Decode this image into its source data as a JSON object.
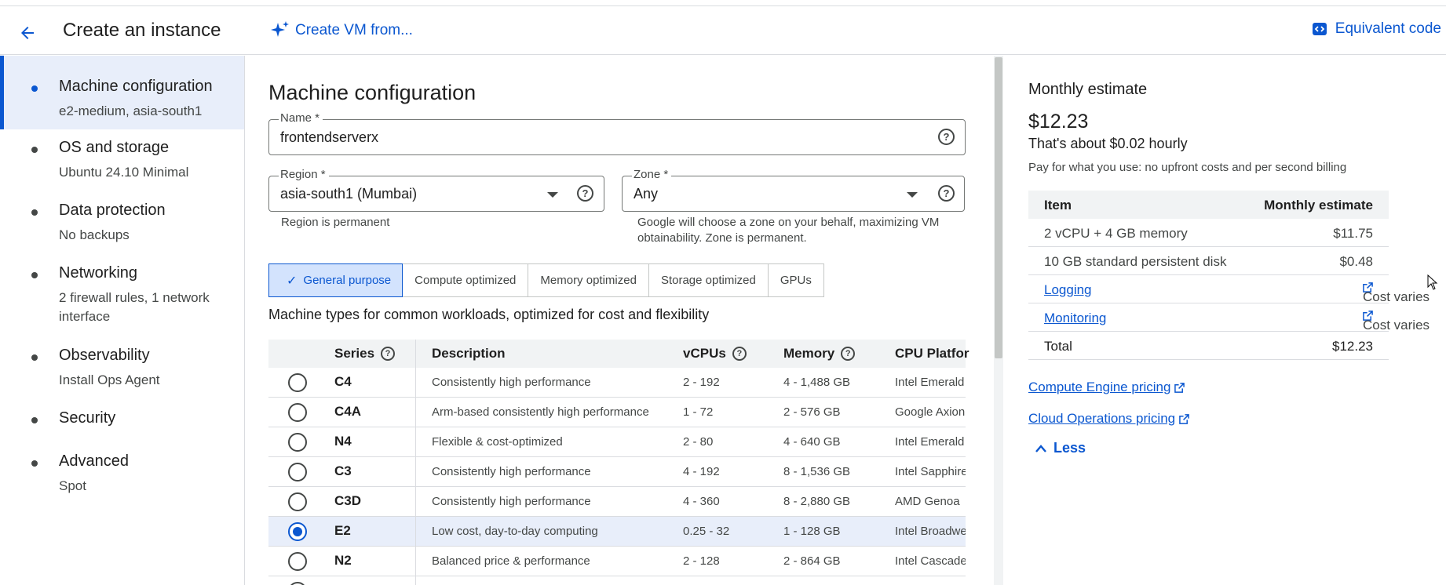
{
  "header": {
    "title": "Create an instance",
    "create_vm_label": "Create VM from...",
    "equivalent_code_label": "Equivalent code"
  },
  "sidebar": {
    "items": [
      {
        "label": "Machine configuration",
        "sub": "e2-medium, asia-south1",
        "active": true
      },
      {
        "label": "OS and storage",
        "sub": "Ubuntu 24.10 Minimal"
      },
      {
        "label": "Data protection",
        "sub": "No backups"
      },
      {
        "label": "Networking",
        "sub": "2 firewall rules, 1 network interface"
      },
      {
        "label": "Observability",
        "sub": "Install Ops Agent"
      },
      {
        "label": "Security",
        "sub": ""
      },
      {
        "label": "Advanced",
        "sub": "Spot"
      }
    ]
  },
  "main": {
    "section_title": "Machine configuration",
    "name_field": {
      "label": "Name *",
      "value": "frontendserverx"
    },
    "region_field": {
      "label": "Region *",
      "value": "asia-south1 (Mumbai)",
      "hint": "Region is permanent"
    },
    "zone_field": {
      "label": "Zone *",
      "value": "Any",
      "hint": "Google will choose a zone on your behalf, maximizing VM obtainability. Zone is permanent."
    },
    "tabs": [
      "General purpose",
      "Compute optimized",
      "Memory optimized",
      "Storage optimized",
      "GPUs"
    ],
    "selected_tab": "General purpose",
    "tab_description": "Machine types for common workloads, optimized for cost and flexibility",
    "table": {
      "headers": {
        "series": "Series",
        "description": "Description",
        "vcpus": "vCPUs",
        "memory": "Memory",
        "cpu_platform": "CPU Platfor"
      },
      "rows": [
        {
          "series": "C4",
          "description": "Consistently high performance",
          "vcpus": "2 - 192",
          "memory": "4 - 1,488 GB",
          "cpu": "Intel Emerald"
        },
        {
          "series": "C4A",
          "description": "Arm-based consistently high performance",
          "vcpus": "1 - 72",
          "memory": "2 - 576 GB",
          "cpu": "Google Axion"
        },
        {
          "series": "N4",
          "description": "Flexible & cost-optimized",
          "vcpus": "2 - 80",
          "memory": "4 - 640 GB",
          "cpu": "Intel Emerald"
        },
        {
          "series": "C3",
          "description": "Consistently high performance",
          "vcpus": "4 - 192",
          "memory": "8 - 1,536 GB",
          "cpu": "Intel Sapphire"
        },
        {
          "series": "C3D",
          "description": "Consistently high performance",
          "vcpus": "4 - 360",
          "memory": "8 - 2,880 GB",
          "cpu": "AMD Genoa"
        },
        {
          "series": "E2",
          "description": "Low cost, day-to-day computing",
          "vcpus": "0.25 - 32",
          "memory": "1 - 128 GB",
          "cpu": "Intel Broadwe",
          "selected": true
        },
        {
          "series": "N2",
          "description": "Balanced price & performance",
          "vcpus": "2 - 128",
          "memory": "2 - 864 GB",
          "cpu": "Intel Cascade"
        }
      ]
    }
  },
  "estimate": {
    "title": "Monthly estimate",
    "price": "$12.23",
    "hourly": "That's about $0.02 hourly",
    "note": "Pay for what you use: no upfront costs and per second billing",
    "table_header_item": "Item",
    "table_header_estimate": "Monthly estimate",
    "rows": [
      {
        "item": "2 vCPU + 4 GB memory",
        "cost": "$11.75"
      },
      {
        "item": "10 GB standard persistent disk",
        "cost": "$0.48"
      },
      {
        "item": "Logging",
        "cost": "Cost varies"
      },
      {
        "item": "Monitoring",
        "cost": "Cost varies"
      },
      {
        "item": "Total",
        "cost": "$12.23"
      }
    ],
    "links": [
      "Compute Engine pricing",
      "Cloud Operations pricing"
    ],
    "less_label": "Less"
  },
  "colors": {
    "accent": "#0b57d0",
    "selected_bg": "#e8eefa",
    "tab_selected_bg": "#d3e3fd",
    "border": "#dadce0"
  }
}
